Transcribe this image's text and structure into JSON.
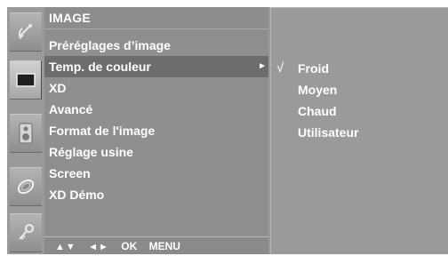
{
  "menu": {
    "title": "IMAGE",
    "items": [
      {
        "label": "Préréglages d’image"
      },
      {
        "label": "Temp. de couleur",
        "selected": true,
        "has_submenu": true
      },
      {
        "label": "XD"
      },
      {
        "label": "Avancé"
      },
      {
        "label": "Format de l'image"
      },
      {
        "label": "Réglage usine"
      },
      {
        "label": "Screen"
      },
      {
        "label": "XD Démo"
      }
    ],
    "submenu_arrow": "►"
  },
  "submenu": {
    "items": [
      {
        "label": "Froid",
        "checked": true,
        "check_mark": "√"
      },
      {
        "label": "Moyen"
      },
      {
        "label": "Chaud"
      },
      {
        "label": "Utilisateur"
      }
    ]
  },
  "footer": {
    "nav_up_down": "▲▼",
    "nav_left_right": "◄►",
    "ok": "OK",
    "menu": "MENU"
  },
  "rail": {
    "icons": [
      "satellite-dish-icon",
      "screen-icon",
      "speaker-icon",
      "clock-icon",
      "key-icon"
    ],
    "active_index": 1
  },
  "colors": {
    "background": "#9a9a9a",
    "selected_row": "#6d6d6d",
    "text": "#ffffff"
  }
}
